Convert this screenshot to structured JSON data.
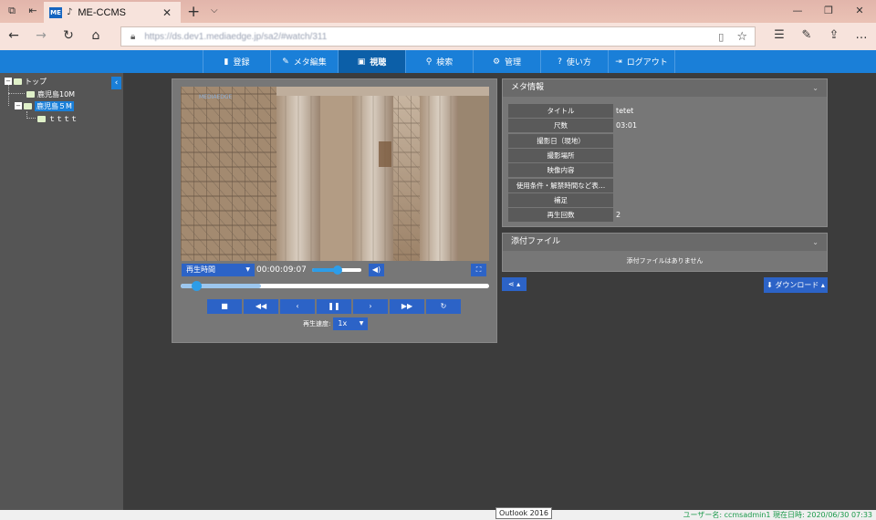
{
  "browser": {
    "tab_title": "ME-CCMS",
    "favicon_text": "ME",
    "url": "https://ds.dev1.mediaedge.jp/sa2/#watch/311",
    "icons": [
      "tab-actions-icon",
      "back-tab-icon",
      "audio-icon",
      "close-icon",
      "new-tab-icon",
      "chevron-down-icon",
      "minimize-icon",
      "restore-icon",
      "close-window-icon",
      "back-icon",
      "forward-icon",
      "refresh-icon",
      "home-icon",
      "lock-icon",
      "reading-view-icon",
      "favorite-star-icon",
      "favorites-list-icon",
      "pen-icon",
      "share-icon",
      "more-icon"
    ]
  },
  "nav": {
    "items": [
      {
        "label": "登録",
        "icon": "document-icon"
      },
      {
        "label": "メタ編集",
        "icon": "pencil-icon"
      },
      {
        "label": "視聴",
        "icon": "play-screen-icon"
      },
      {
        "label": "検索",
        "icon": "search-icon"
      },
      {
        "label": "管理",
        "icon": "gear-icon"
      },
      {
        "label": "使い方",
        "icon": "question-icon"
      },
      {
        "label": "ログアウト",
        "icon": "logout-icon"
      }
    ],
    "active_index": 2
  },
  "sidebar": {
    "tree": [
      {
        "label": "トップ",
        "level": 0
      },
      {
        "label": "鹿児島10M",
        "level": 1
      },
      {
        "label": "鹿児島５M",
        "level": 1,
        "selected": true
      },
      {
        "label": "ｔｔｔｔ",
        "level": 2
      }
    ]
  },
  "player": {
    "time_mode": "再生時間",
    "timecode": "00:00:09:07",
    "volume_level": 0.52,
    "seek_position": 0.05,
    "video_watermark": "MEDIAEDGE",
    "speed_label": "再生速度:",
    "speed_value": "1x",
    "transport": [
      "stop-icon",
      "rewind-icon",
      "step-back-icon",
      "pause-icon",
      "step-forward-icon",
      "fast-forward-icon",
      "repeat-icon"
    ]
  },
  "meta": {
    "title": "メタ情報",
    "rows": [
      {
        "key": "タイトル",
        "value": "tetet"
      },
      {
        "key": "尺数",
        "value": "03:01"
      },
      {
        "key": "撮影日（現地）",
        "value": ""
      },
      {
        "key": "撮影場所",
        "value": ""
      },
      {
        "key": "映像内容",
        "value": ""
      },
      {
        "key": "使用条件・解禁時間など表…",
        "value": ""
      },
      {
        "key": "補足",
        "value": ""
      },
      {
        "key": "再生回数",
        "value": "2"
      }
    ]
  },
  "attachments": {
    "title": "添付ファイル",
    "empty_text": "添付ファイルはありません"
  },
  "actions": {
    "download_label": "ダウンロード"
  },
  "status": {
    "text": "ユーザー名: ccmsadmin1  現在日時: 2020/06/30 07:33"
  },
  "tooltip": "Outlook 2016",
  "colors": {
    "accent": "#1a7fd8",
    "button": "#2c63c7",
    "background": "#3c3c3c",
    "panel": "#777777",
    "status_green": "#1a9a4a"
  }
}
